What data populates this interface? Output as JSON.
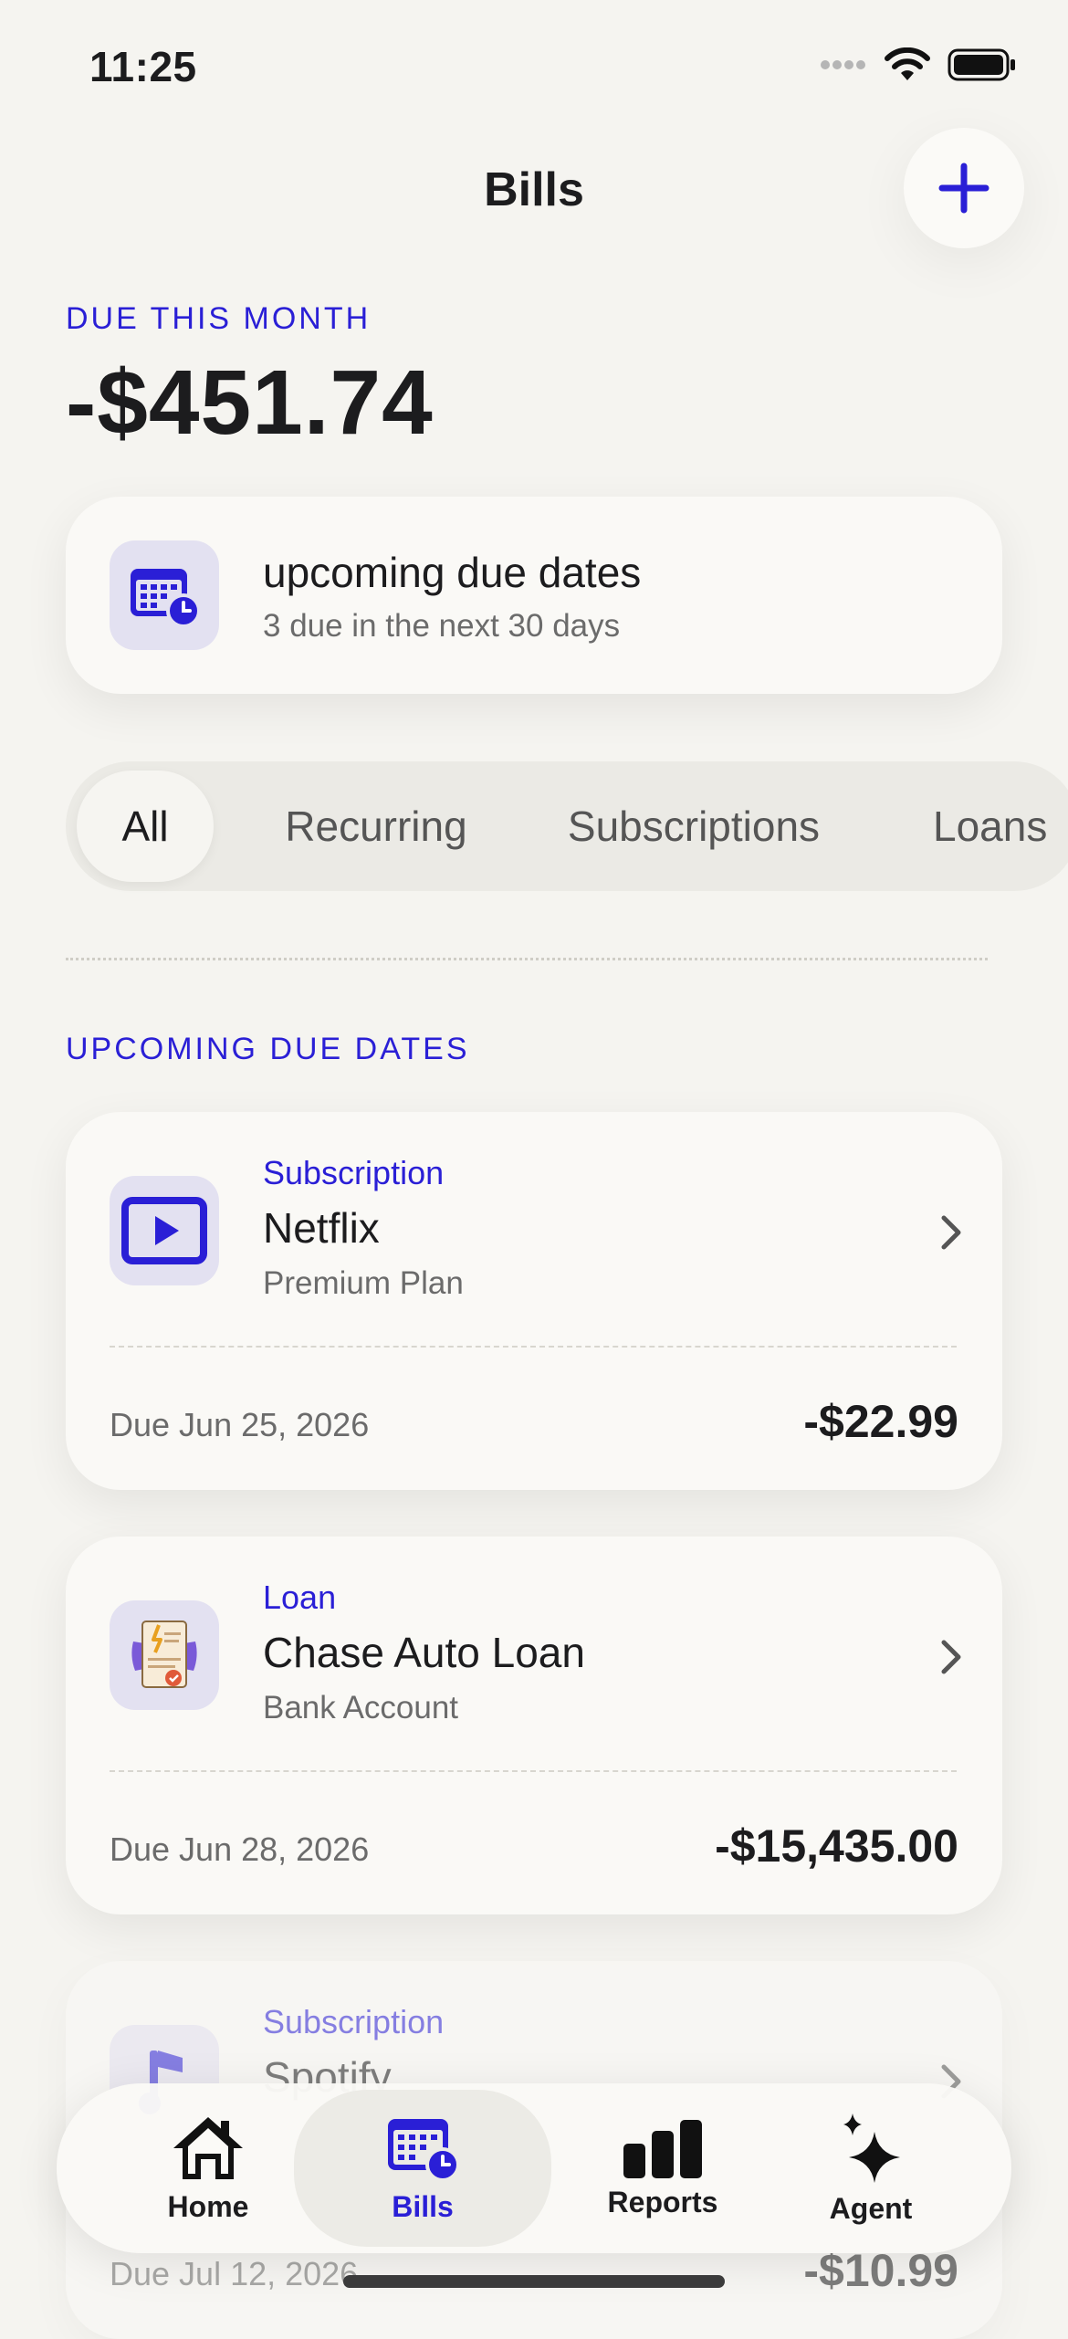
{
  "status_bar": {
    "time": "11:25"
  },
  "header": {
    "title": "Bills",
    "add_icon": "plus-icon"
  },
  "summary": {
    "label": "DUE THIS MONTH",
    "total": "-$451.74",
    "card_title": "upcoming due dates",
    "card_subtitle": "3 due in the next 30 days",
    "card_icon": "calendar-clock-icon"
  },
  "filters": {
    "tabs": [
      {
        "label": "All",
        "active": true
      },
      {
        "label": "Recurring",
        "active": false
      },
      {
        "label": "Subscriptions",
        "active": false
      },
      {
        "label": "Loans",
        "active": false
      }
    ]
  },
  "upcoming": {
    "label": "UPCOMING DUE DATES",
    "bills": [
      {
        "category": "Subscription",
        "name": "Netflix",
        "detail": "Premium Plan",
        "due": "Due Jun 25, 2026",
        "amount": "-$22.99",
        "icon": "play-icon"
      },
      {
        "category": "Loan",
        "name": "Chase Auto Loan",
        "detail": "Bank Account",
        "due": "Due Jun 28, 2026",
        "amount": "-$15,435.00",
        "icon": "document-icon"
      },
      {
        "category": "Subscription",
        "name": "Spotify",
        "detail": "",
        "due": "Due Jul 12, 2026",
        "amount": "-$10.99",
        "icon": "music-note-icon"
      }
    ]
  },
  "nav": {
    "items": [
      {
        "label": "Home",
        "icon": "home-icon",
        "active": false
      },
      {
        "label": "Bills",
        "icon": "calendar-clock-icon",
        "active": true
      },
      {
        "label": "Reports",
        "icon": "bar-chart-icon",
        "active": false
      },
      {
        "label": "Agent",
        "icon": "sparkle-icon",
        "active": false
      }
    ]
  },
  "colors": {
    "accent": "#2a1fd6",
    "background": "#f5f4f0",
    "card": "#faf9f6"
  }
}
